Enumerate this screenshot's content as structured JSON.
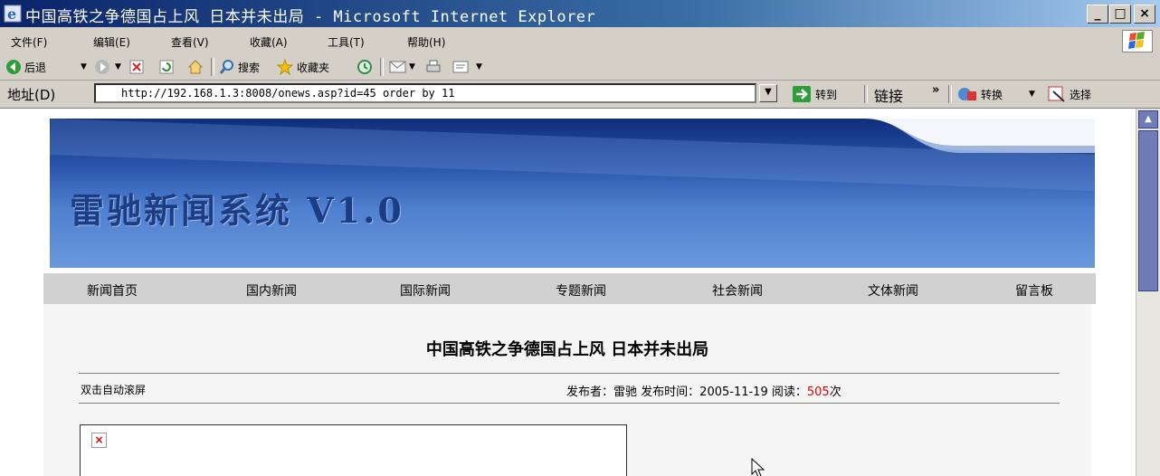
{
  "window": {
    "title": "中国高铁之争德国占上风 日本并未出局 - Microsoft Internet Explorer",
    "buttons": {
      "minimize": "_",
      "maximize": "□",
      "close": "×"
    }
  },
  "menu": [
    "文件(F)",
    "编辑(E)",
    "查看(V)",
    "收藏(A)",
    "工具(T)",
    "帮助(H)"
  ],
  "toolbar": {
    "back": "后退",
    "search": "搜索",
    "favorites": "收藏夹"
  },
  "address": {
    "label": "地址(D)",
    "url": "http://192.168.1.3:8008/onews.asp?id=45 order by 11",
    "go": "转到",
    "links": "链接",
    "more": "»",
    "convert": "转换",
    "select": "选择"
  },
  "site": {
    "banner_title": "雷驰新闻系统 V1.0",
    "nav": [
      "新闻首页",
      "国内新闻",
      "国际新闻",
      "专题新闻",
      "社会新闻",
      "文体新闻",
      "留言板"
    ]
  },
  "article": {
    "headline": "中国高铁之争德国占上风 日本并未出局",
    "autoscroll": "双击自动滚屏",
    "publisher_label": "发布者：",
    "publisher": "雷驰",
    "time_label": " 发布时间：",
    "time": "2005-11-19",
    "reads_label": " 阅读：",
    "reads": "505",
    "reads_unit": "次"
  },
  "colors": {
    "title_bar": "#0a246a",
    "chrome": "#d4d0c8",
    "banner": "#2853a8",
    "reads_count": "#e00000"
  },
  "icons": [
    "ie-logo-icon",
    "windows-logo-icon",
    "back-icon",
    "forward-icon",
    "stop-icon",
    "refresh-icon",
    "home-icon",
    "search-icon",
    "favorites-star-icon",
    "history-icon",
    "mail-icon",
    "print-icon",
    "edit-icon",
    "go-arrow-icon",
    "convert-icon",
    "select-icon",
    "broken-image-icon",
    "mouse-cursor-icon"
  ]
}
